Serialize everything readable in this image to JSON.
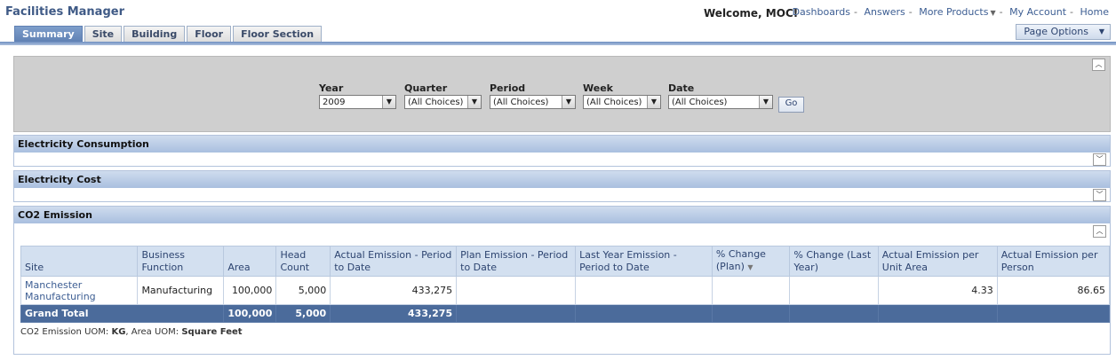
{
  "app_title": "Facilities Manager",
  "welcome": "Welcome, MOC!",
  "top_links": [
    "Dashboards",
    "Answers",
    "More Products",
    "My Account",
    "Home"
  ],
  "tabs": [
    "Summary",
    "Site",
    "Building",
    "Floor",
    "Floor Section"
  ],
  "active_tab": "Summary",
  "page_options": "Page Options",
  "prompts": {
    "year": {
      "label": "Year",
      "value": "2009"
    },
    "quarter": {
      "label": "Quarter",
      "value": "(All Choices)"
    },
    "period": {
      "label": "Period",
      "value": "(All Choices)"
    },
    "week": {
      "label": "Week",
      "value": "(All Choices)"
    },
    "date": {
      "label": "Date",
      "value": "(All Choices)"
    },
    "go": "Go"
  },
  "sections": {
    "electricity_consumption": "Electricity Consumption",
    "electricity_cost": "Electricity Cost",
    "co2_emission": "CO2 Emission"
  },
  "table": {
    "headers": {
      "site": "Site",
      "business_function": "Business Function",
      "area": "Area",
      "head_count": "Head Count",
      "actual_emission": "Actual Emission - Period to Date",
      "plan_emission": "Plan Emission - Period to Date",
      "last_year_emission": "Last Year Emission - Period to Date",
      "pct_change_plan": "% Change (Plan)",
      "pct_change_last_year": "% Change (Last Year)",
      "per_unit_area": "Actual Emission per Unit Area",
      "per_person": "Actual Emission per Person"
    },
    "row": {
      "site": "Manchester Manufacturing",
      "business_function": "Manufacturing",
      "area": "100,000",
      "head_count": "5,000",
      "actual_emission": "433,275",
      "plan_emission": "",
      "last_year_emission": "",
      "pct_change_plan": "",
      "pct_change_last_year": "",
      "per_unit_area": "4.33",
      "per_person": "86.65"
    },
    "total": {
      "label": "Grand Total",
      "area": "100,000",
      "head_count": "5,000",
      "actual_emission": "433,275"
    }
  },
  "uom": {
    "co2_label": "CO2 Emission UOM:",
    "co2_value": "KG",
    "area_label": ", Area UOM:",
    "area_value": "Square Feet"
  }
}
